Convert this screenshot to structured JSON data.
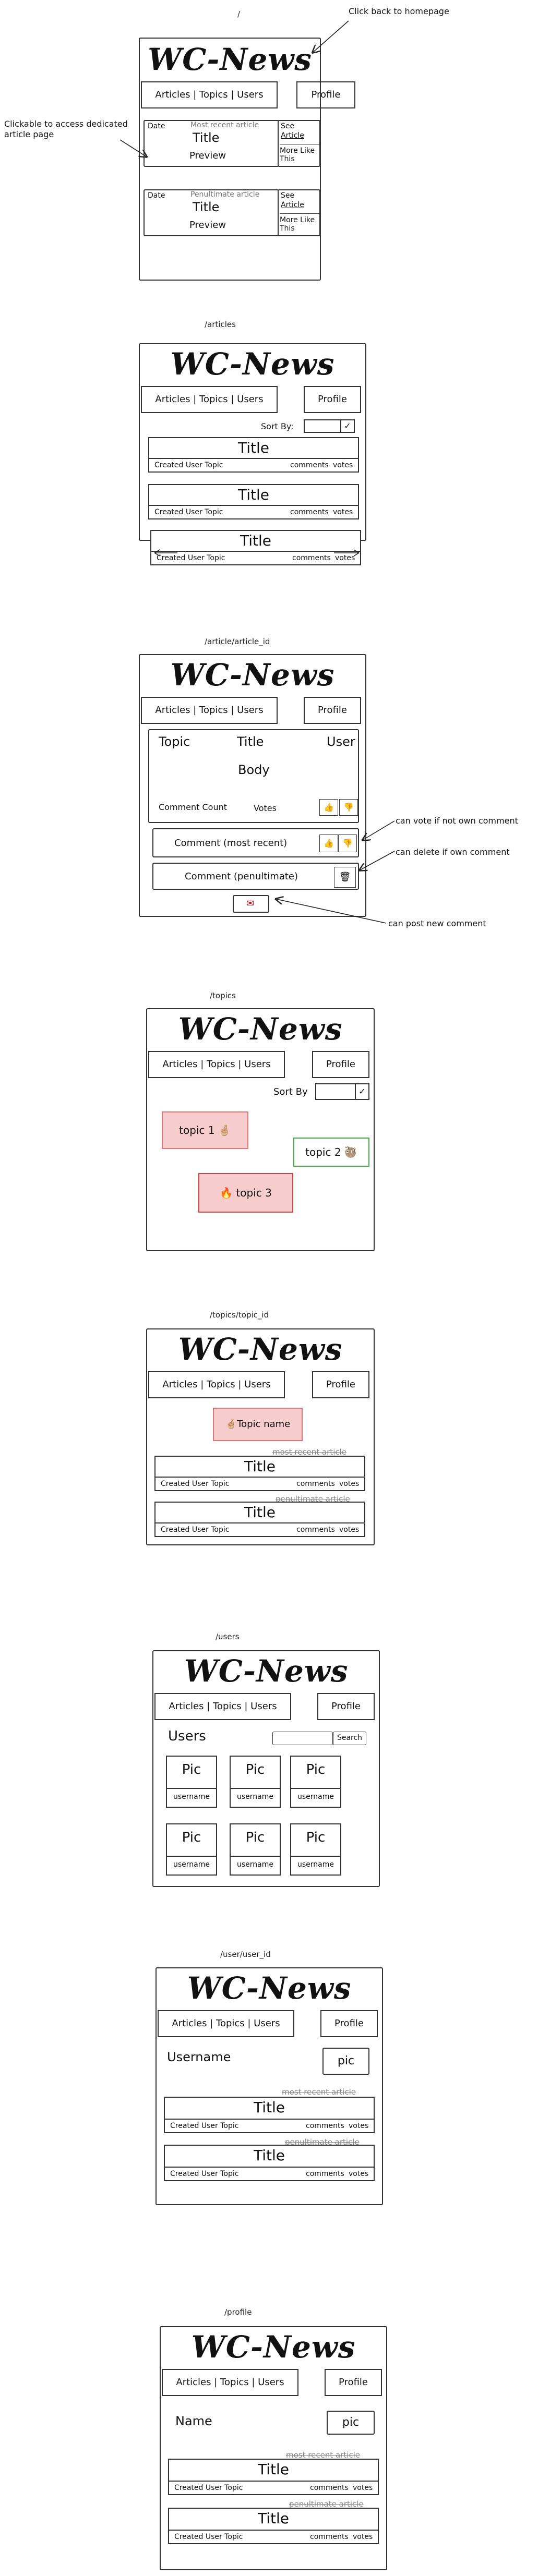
{
  "pages": {
    "home": {
      "route": "/",
      "logo": "WC-News",
      "nav": "Articles | Topics | Users",
      "profile": "Profile",
      "cards": [
        {
          "date": "Date",
          "label": "Most recent article",
          "title": "Title",
          "preview": "Preview",
          "see": "See",
          "article": "Article",
          "more": "More Like This"
        },
        {
          "date": "Date",
          "label": "Penultimate article",
          "title": "Title",
          "preview": "Preview",
          "see": "See",
          "article": "Article",
          "more": "More Like This"
        }
      ],
      "note_back": "Click back to homepage",
      "note_clickable": "Clickable to access dedicated article page"
    },
    "articles": {
      "route": "/articles",
      "logo": "WC-News",
      "nav": "Articles | Topics | Users",
      "profile": "Profile",
      "sort_label": "Sort By:",
      "check": "✓",
      "items": [
        {
          "title": "Title",
          "meta": "Created User Topic",
          "comments": "comments",
          "votes": "votes"
        },
        {
          "title": "Title",
          "meta": "Created User Topic",
          "comments": "comments",
          "votes": "votes"
        },
        {
          "title": "Title",
          "meta": "Created User Topic",
          "comments": "comments",
          "votes": "votes"
        }
      ]
    },
    "article": {
      "route": "/article/article_id",
      "logo": "WC-News",
      "nav": "Articles | Topics | Users",
      "profile": "Profile",
      "topic": "Topic",
      "title": "Title",
      "user": "User",
      "body": "Body",
      "comment_count": "Comment Count",
      "votes": "Votes",
      "comment1": "Comment (most recent)",
      "comment2": "Comment (penultimate)",
      "note_vote": "can vote if not own comment",
      "note_delete": "can delete if own comment",
      "note_post": "can post new comment"
    },
    "topics": {
      "route": "/topics",
      "logo": "WC-News",
      "nav": "Articles | Topics | Users",
      "profile": "Profile",
      "sort_label": "Sort By",
      "check": "✓",
      "topic1": "topic 1",
      "topic2": "topic 2",
      "topic3": "topic 3"
    },
    "topic": {
      "route": "/topics/topic_id",
      "logo": "WC-News",
      "nav": "Articles | Topics | Users",
      "profile": "Profile",
      "topic_name": "Topic name",
      "label1": "most recent article",
      "label2": "penultimate article",
      "items": [
        {
          "title": "Title",
          "meta": "Created User Topic",
          "comments": "comments",
          "votes": "votes"
        },
        {
          "title": "Title",
          "meta": "Created User Topic",
          "comments": "comments",
          "votes": "votes"
        }
      ]
    },
    "users": {
      "route": "/users",
      "logo": "WC-News",
      "nav": "Articles | Topics | Users",
      "profile": "Profile",
      "heading": "Users",
      "search": "Search",
      "pic": "Pic",
      "username": "username"
    },
    "user": {
      "route": "/user/user_id",
      "logo": "WC-News",
      "nav": "Articles | Topics | Users",
      "profile": "Profile",
      "name": "Username",
      "pic": "pic",
      "label1": "most recent article",
      "label2": "penultimate article",
      "items": [
        {
          "title": "Title",
          "meta": "Created User Topic",
          "comments": "comments",
          "votes": "votes"
        },
        {
          "title": "Title",
          "meta": "Created User Topic",
          "comments": "comments",
          "votes": "votes"
        }
      ]
    },
    "profile": {
      "route": "/profile",
      "logo": "WC-News",
      "nav": "Articles | Topics | Users",
      "profile": "Profile",
      "name": "Name",
      "pic": "pic",
      "label1": "most recent article",
      "label2": "penultimate article",
      "items": [
        {
          "title": "Title",
          "meta": "Created User Topic",
          "comments": "comments",
          "votes": "votes"
        },
        {
          "title": "Title",
          "meta": "Created User Topic",
          "comments": "comments",
          "votes": "votes"
        }
      ]
    }
  }
}
